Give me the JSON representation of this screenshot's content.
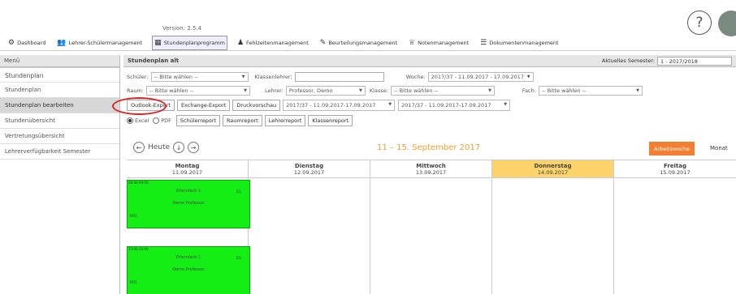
{
  "app": {
    "version": "Version: 2.5.4",
    "help_glyph": "?"
  },
  "topnav": [
    {
      "label": "Dashboard",
      "icon": "dashboard-icon",
      "glyph": "⚙"
    },
    {
      "label": "Lehrer-Schülermanagement",
      "icon": "users-icon",
      "glyph": "👥"
    },
    {
      "label": "Stundenplanprogramm",
      "icon": "calendar-icon",
      "glyph": "▦"
    },
    {
      "label": "Fehlzeitenmanagement",
      "icon": "person-icon",
      "glyph": "♟"
    },
    {
      "label": "Beurteilungsmanagement",
      "icon": "pencil-icon",
      "glyph": "✎"
    },
    {
      "label": "Notenmanagement",
      "icon": "award-icon",
      "glyph": "♕"
    },
    {
      "label": "Dokumentenmanagement",
      "icon": "document-icon",
      "glyph": "☰"
    }
  ],
  "sidebar": {
    "header": "Menü",
    "section": "Stundenplan",
    "items": [
      "Stundenplan",
      "Stundenplan bearbeiten",
      "Stundenübersicht",
      "Vertretungsübersicht",
      "Lehrerverfügbarkeit Semester"
    ],
    "active_index": 1
  },
  "main": {
    "title": "Stundenplan alt",
    "semester_label": "Aktuelles Semester:",
    "semester_value": "1 - 2017/2018"
  },
  "filters": {
    "schueler_label": "Schüler:",
    "schueler_value": "-- Bitte wählen --",
    "klassenlehrer_label": "Klassenlehrer:",
    "klassenlehrer_value": "",
    "woche_label": "Woche:",
    "woche_value": "2017/37 - 11.09.2017 - 17.09.2017",
    "raum_label": "Raum:",
    "raum_value": "-- Bitte wählen --",
    "lehrer_label": "Lehrer:",
    "lehrer_value": "Professor, Demo",
    "klasse_label": "Klasse:",
    "klasse_value": "-- Bitte wählen --",
    "fach_label": "Fach:",
    "fach_value": "-- Bitte wählen --"
  },
  "export_row": {
    "outlook": "Outlook-Export",
    "exchange": "Exchange-Export",
    "druck": "Druckvorschau",
    "range_from": "2017/37 - 11.09.2017-17.09.2017",
    "range_to": "2017/37 - 11.09.2017-17.09.2017"
  },
  "format_row": {
    "excel": "Excel",
    "pdf": "PDF",
    "schueler": "Schülerreport",
    "raum": "Raumreport",
    "lehrer": "Lehrerreport",
    "klassen": "Klassenreport"
  },
  "calendar": {
    "heute": "Heute",
    "date_range": "11 – 15. September 2017",
    "work_week_btn": "Arbeitswoche",
    "month_btn": "Monat",
    "days": [
      {
        "name": "Montag",
        "date": "11.09.2017",
        "today": false
      },
      {
        "name": "Dienstag",
        "date": "12.09.2017",
        "today": false
      },
      {
        "name": "Mittwoch",
        "date": "13.09.2017",
        "today": false
      },
      {
        "name": "Donnerstag",
        "date": "14.09.2017",
        "today": true
      },
      {
        "name": "Freitag",
        "date": "15.09.2017",
        "today": false
      }
    ],
    "events": [
      {
        "time": "08:00-09:00",
        "title": "Erlernfach 1",
        "teacher": "Demo Professor",
        "room": "R01",
        "code": "E1"
      },
      {
        "time": "13:00-14:00",
        "title": "Erlernfach 1",
        "teacher": "Demo Professor",
        "room": "R01",
        "code": "E1"
      }
    ]
  }
}
